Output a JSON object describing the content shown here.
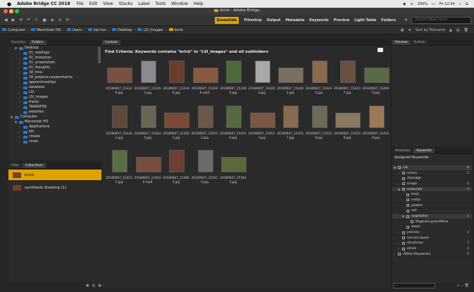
{
  "menubar": {
    "app": "Adobe Bridge CC 2018",
    "items": [
      "File",
      "Edit",
      "View",
      "Stacks",
      "Label",
      "Tools",
      "Window",
      "Help"
    ],
    "battery": "100%",
    "clock": "Fri 12:54"
  },
  "window": {
    "title": "brick - Adobe Bridge"
  },
  "toolbar": {
    "workspaces": [
      "Essentials",
      "Filmstrip",
      "Output",
      "Metadata",
      "Keywords",
      "Preview",
      "Light Table",
      "Folders"
    ],
    "search_placeholder": "Search Adobe Stock",
    "sort_label": "Sort by Filename"
  },
  "pathbar": {
    "crumbs": [
      "Computer",
      "Macintosh HD",
      "Users",
      "karl-lsn",
      "Desktop",
      "LSI_images",
      "brick"
    ]
  },
  "left": {
    "tabs": [
      "Favorites",
      "Folders"
    ],
    "tree": [
      {
        "label": "Desktop",
        "indent": 1,
        "open": true
      },
      {
        "label": "01_readings",
        "indent": 2
      },
      {
        "label": "01_resources",
        "indent": 2
      },
      {
        "label": "01_screenshots",
        "indent": 2
      },
      {
        "label": "01_thoughts",
        "indent": 2
      },
      {
        "label": "18_misc",
        "indent": 2
      },
      {
        "label": "18_projects+experiments",
        "indent": 2
      },
      {
        "label": "apprenticeships",
        "indent": 2
      },
      {
        "label": "database",
        "indent": 2
      },
      {
        "label": "LSI",
        "indent": 2
      },
      {
        "label": "LSI_images",
        "indent": 2
      },
      {
        "label": "thesis",
        "indent": 2
      },
      {
        "label": "TRANSFER",
        "indent": 2
      },
      {
        "label": "websites",
        "indent": 2
      },
      {
        "label": "Computer",
        "indent": 0,
        "open": true
      },
      {
        "label": "Macintosh HD",
        "indent": 1,
        "open": true
      },
      {
        "label": "Applications",
        "indent": 2
      },
      {
        "label": "bin",
        "indent": 2
      },
      {
        "label": "cmake",
        "indent": 2
      },
      {
        "label": "cores",
        "indent": 2
      }
    ],
    "bottom_tabs": [
      "Filter",
      "Collections"
    ],
    "collections": [
      {
        "label": "brick",
        "selected": true
      },
      {
        "label": "synthesis drawing (1)",
        "selected": false
      }
    ]
  },
  "content": {
    "tab": "Content",
    "find_criteria": "Find Criteria:  Keywords contains \"brick\" in \"LSI_images\" and all subfolders",
    "rows": [
      [
        {
          "l1": "20180607_15322",
          "l2": "9.jpg",
          "color": "#7a5040"
        },
        {
          "l1": "20180607_15326",
          "l2": "1.jpg",
          "color": "#8a8a90"
        },
        {
          "l1": "20180607_15344",
          "l2": "6.jpg",
          "color": "#6a3c2c"
        },
        {
          "l1": "20180607_15350",
          "l2": "6.mp4",
          "color": "#8a5a40"
        },
        {
          "l1": "20180607_15350",
          "l2": "6.jpg",
          "color": "#4e6a3a"
        },
        {
          "l1": "20180607_15420",
          "l2": "3.jpg",
          "color": "#a8a8a8"
        },
        {
          "l1": "20180607_15440",
          "l2": "3.jpg",
          "color": "#7a7060"
        },
        {
          "l1": "20180607_15443",
          "l2": "2.jpg",
          "color": "#8c6a4e"
        },
        {
          "l1": "20180607_15443",
          "l2": "7.jpg",
          "color": "#6a5040"
        },
        {
          "l1": "20180607_15444",
          "l2": "0.jpg",
          "color": "#5a6a46"
        }
      ],
      [
        {
          "l1": "20180607_15444",
          "l2": "2.jpg",
          "color": "#5e4a3a"
        },
        {
          "l1": "20180607_15444",
          "l2": "4.jpg",
          "color": "#6a6656"
        },
        {
          "l1": "20180607_15450",
          "l2": "1.jpg",
          "color": "#7a4a38"
        },
        {
          "l1": "20180607_15451",
          "l2": "2.jpg",
          "color": "#6c584a"
        },
        {
          "l1": "20180607_15451",
          "l2": "6.jpg",
          "color": "#556a40"
        },
        {
          "l1": "20180607_15452",
          "l2": "3.jpg",
          "color": "#7c5844"
        },
        {
          "l1": "20180607_15452",
          "l2": "7.jpg",
          "color": "#8a6a50"
        },
        {
          "l1": "20180607_15452",
          "l2": "9.jpg",
          "color": "#6e6a58"
        },
        {
          "l1": "20180607_15453",
          "l2": "6.jpg",
          "color": "#8a7a62"
        },
        {
          "l1": "20180607_15452",
          "l2": "9.jpg",
          "color": "#9a7a58"
        }
      ],
      [
        {
          "l1": "20180607_15453",
          "l2": "2.jpg",
          "color": "#5a6e44"
        },
        {
          "l1": "20180607_15454",
          "l2": "0.mp4",
          "color": "#7a4e3e"
        },
        {
          "l1": "20180607_15480",
          "l2": "3.jpg",
          "color": "#6e3e30"
        },
        {
          "l1": "20180607_15541",
          "l2": "0.jpg",
          "color": "#6a6a6a"
        },
        {
          "l1": "20180607_15581",
          "l2": "3.jpg",
          "color": "#5c6a3a"
        }
      ]
    ]
  },
  "right": {
    "top_tabs": [
      "Preview",
      "Publish"
    ],
    "meta_tabs": [
      "Metadata",
      "Keywords"
    ],
    "assigned": "Assigned Keywords:",
    "keywords": [
      {
        "label": "LSI",
        "indent": 0,
        "count": "8",
        "tri": true,
        "band": true
      },
      {
        "label": "actors",
        "indent": 1,
        "count": "2",
        "tri": true,
        "band": false
      },
      {
        "label": "drainage",
        "indent": 1,
        "count": "",
        "tri": false,
        "band": false
      },
      {
        "label": "image",
        "indent": 1,
        "count": "4",
        "tri": true,
        "band": false
      },
      {
        "label": "materials",
        "indent": 1,
        "count": "5",
        "tri": true,
        "band": true
      },
      {
        "label": "brick",
        "indent": 2,
        "count": "",
        "tri": false,
        "band": false
      },
      {
        "label": "metal",
        "indent": 2,
        "count": "",
        "tri": false,
        "band": false
      },
      {
        "label": "plaster",
        "indent": 2,
        "count": "",
        "tri": false,
        "band": false
      },
      {
        "label": "soil",
        "indent": 2,
        "count": "",
        "tri": false,
        "band": false
      },
      {
        "label": "vegetation",
        "indent": 2,
        "count": "1",
        "tri": true,
        "band": true
      },
      {
        "label": "Magnolia grandiflora",
        "indent": 3,
        "count": "",
        "tri": false,
        "band": false
      },
      {
        "label": "wood",
        "indent": 2,
        "count": "",
        "tri": false,
        "band": false
      },
      {
        "label": "process",
        "indent": 1,
        "count": "2",
        "tri": true,
        "band": false
      },
      {
        "label": "service-space",
        "indent": 1,
        "count": "",
        "tri": false,
        "band": false
      },
      {
        "label": "structures",
        "indent": 1,
        "count": "7",
        "tri": true,
        "band": false
      },
      {
        "label": "zones",
        "indent": 1,
        "count": "2",
        "tri": true,
        "band": false
      },
      {
        "label": "(Other Keywords)",
        "indent": 0,
        "count": "5",
        "tri": true,
        "band": false
      }
    ]
  },
  "colors": {
    "accent": "#e0a300",
    "folder": "#2b78c8",
    "panel": "#2b2b2b"
  }
}
